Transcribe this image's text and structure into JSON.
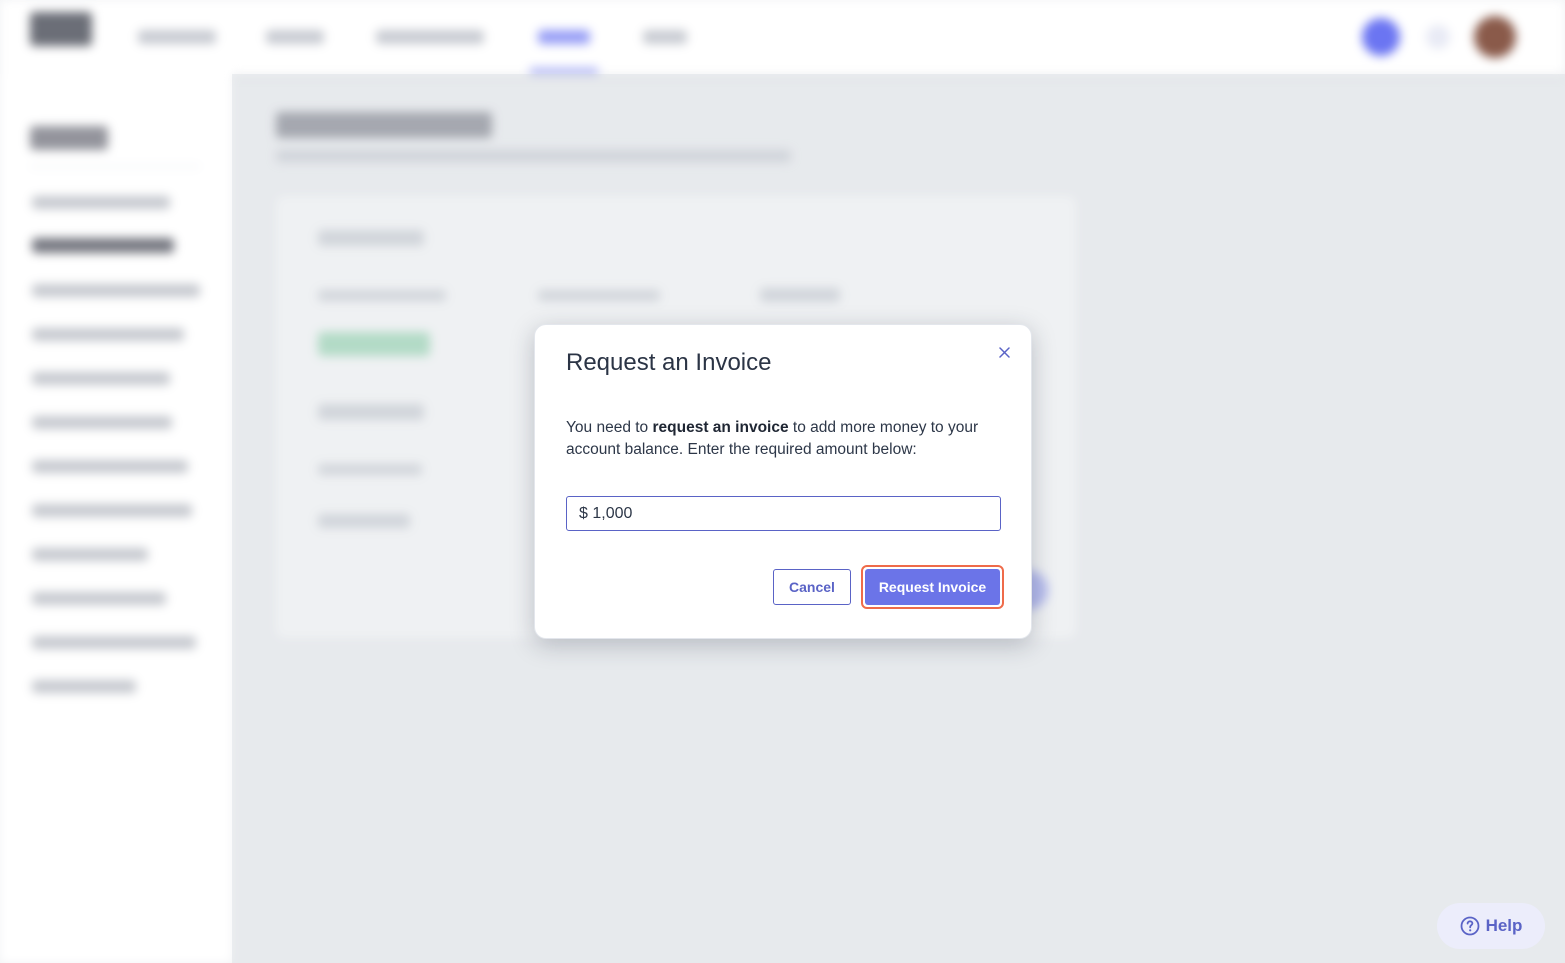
{
  "modal": {
    "title": "Request an Invoice",
    "body_prefix": "You need to ",
    "body_bold": "request an invoice",
    "body_suffix": " to add more money to your account balance. Enter the required amount below:",
    "amount_value": "$ 1,000",
    "cancel_label": "Cancel",
    "submit_label": "Request Invoice",
    "close_icon": "close-icon"
  },
  "help": {
    "label": "Help",
    "icon": "question-circle-icon"
  },
  "colors": {
    "accent": "#6b74e8",
    "focus_ring": "#ef6b4a"
  }
}
